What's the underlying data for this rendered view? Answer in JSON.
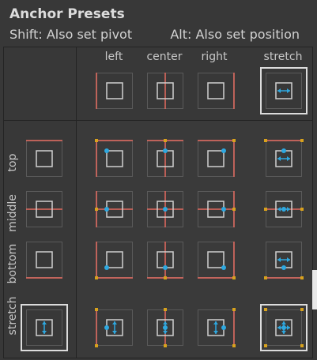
{
  "panel": {
    "title": "Anchor Presets",
    "hint_left": "Shift: Also set pivot",
    "hint_right": "Alt: Also set position"
  },
  "columns": [
    "left",
    "center",
    "right",
    "stretch"
  ],
  "rows": [
    "top",
    "middle",
    "bottom",
    "stretch"
  ],
  "colors": {
    "accent": "#e46a5f",
    "pivot": "#2ea8e0",
    "handle": "#d8a21c",
    "border": "#5a5a5a"
  },
  "selected": {
    "header_col": "stretch",
    "header_row": "stretch"
  },
  "icons": [
    "anchor-preset-icon"
  ]
}
